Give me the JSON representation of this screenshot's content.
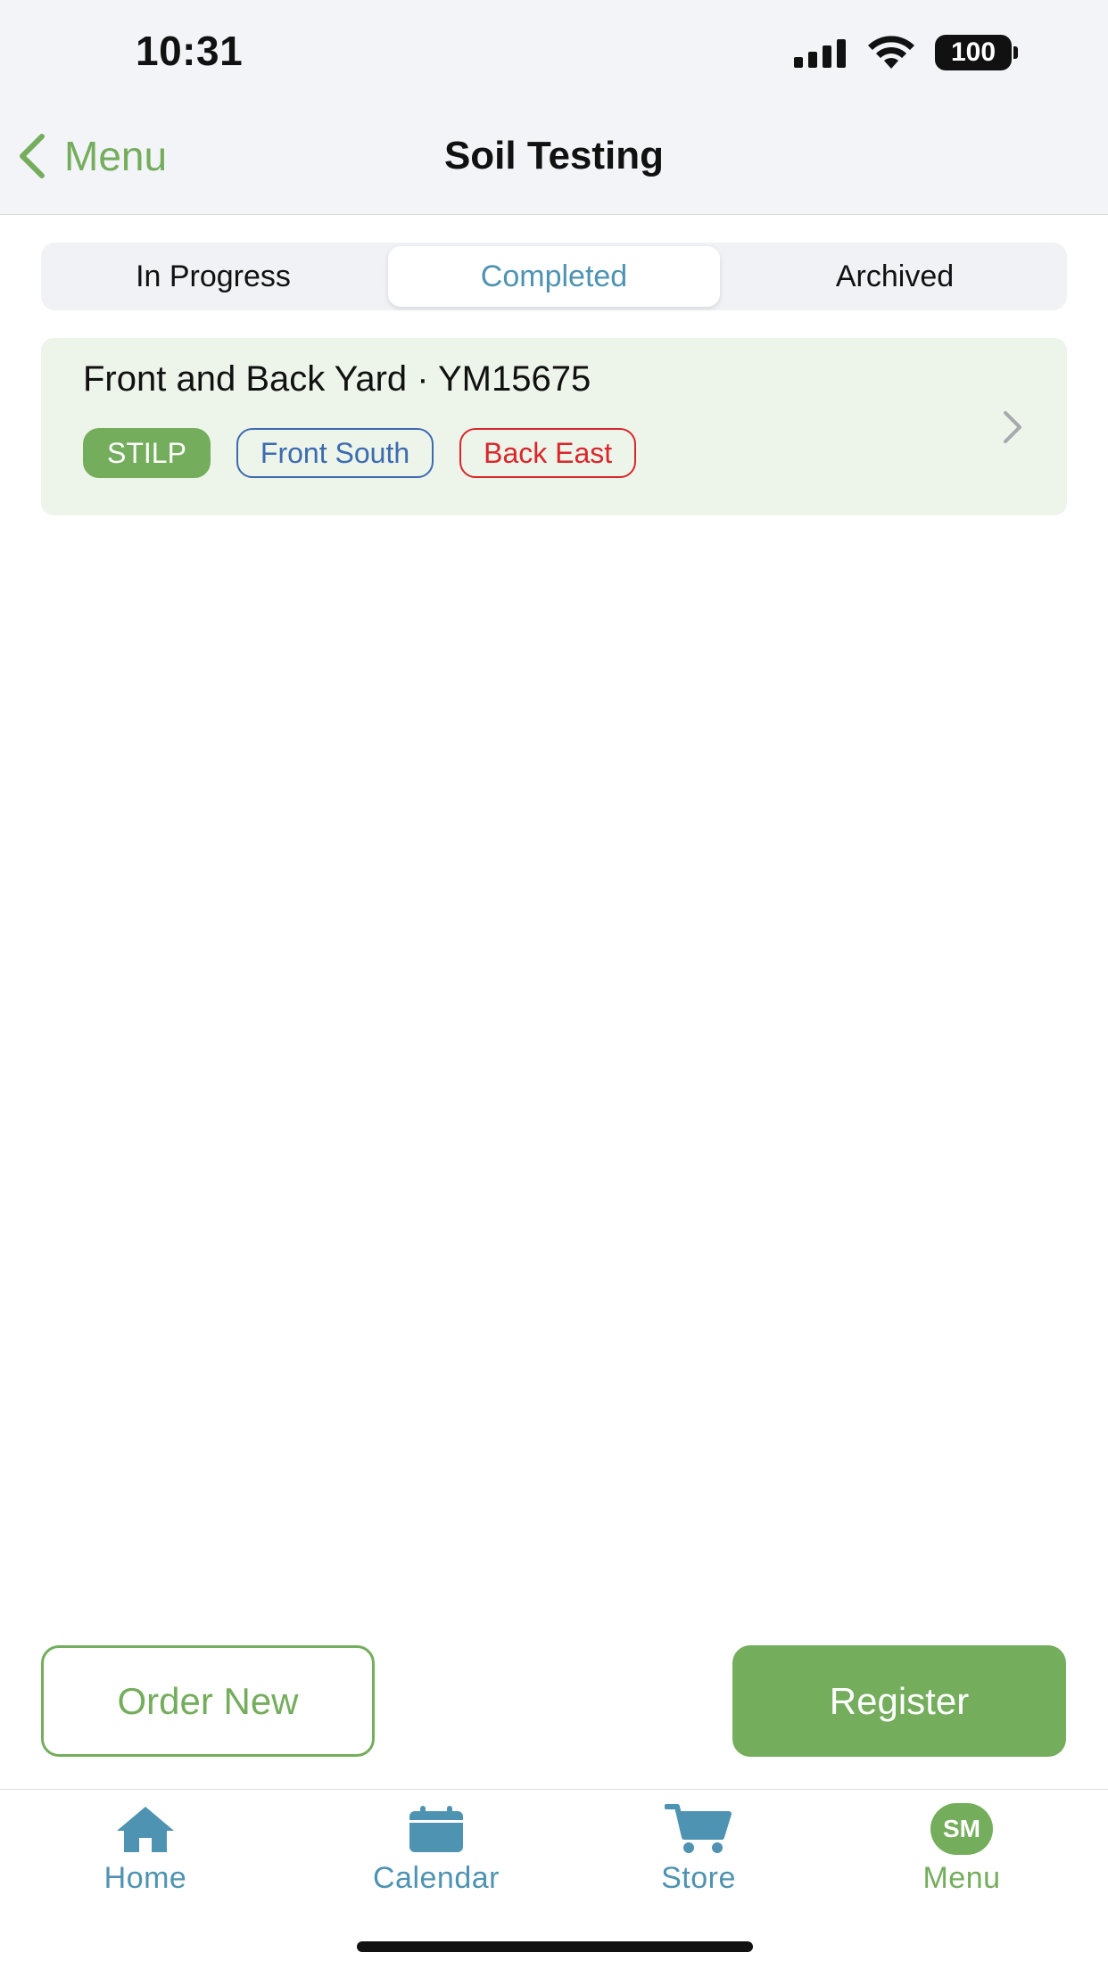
{
  "status_bar": {
    "time": "10:31",
    "battery": "100"
  },
  "nav": {
    "back_label": "Menu",
    "title": "Soil Testing"
  },
  "segments": [
    {
      "label": "In Progress",
      "selected": false
    },
    {
      "label": "Completed",
      "selected": true
    },
    {
      "label": "Archived",
      "selected": false
    }
  ],
  "cards": [
    {
      "title": "Front and Back Yard · YM15675",
      "tags": [
        {
          "label": "STILP",
          "color": "#74ad5c"
        },
        {
          "label": "Front South",
          "color": "#3c6bb0"
        },
        {
          "label": "Back East",
          "color": "#d9262b"
        }
      ]
    }
  ],
  "actions": {
    "order_new": "Order New",
    "register": "Register"
  },
  "tabbar": [
    {
      "label": "Home",
      "icon": "home-icon",
      "active": false
    },
    {
      "label": "Calendar",
      "icon": "calendar-icon",
      "active": false
    },
    {
      "label": "Store",
      "icon": "cart-icon",
      "active": false
    },
    {
      "label": "Menu",
      "icon": "avatar",
      "avatar_initials": "SM",
      "active": true
    }
  ],
  "colors": {
    "accent_green": "#74ad5c",
    "accent_blue": "#4e93b1",
    "card_bg": "#edf4ea"
  }
}
